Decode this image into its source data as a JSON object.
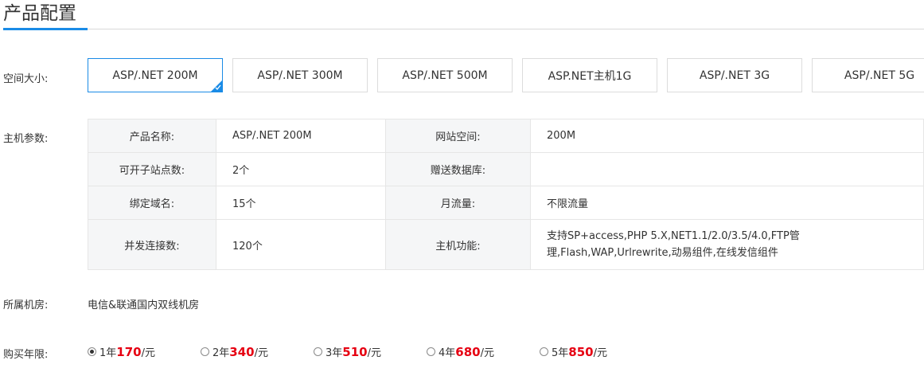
{
  "page_title": "产品配置",
  "labels": {
    "size": "空间大小:",
    "params": "主机参数:",
    "room": "所属机房:",
    "years": "购买年限:"
  },
  "size_options": [
    {
      "label": "ASP/.NET 200M",
      "selected": true
    },
    {
      "label": "ASP/.NET 300M",
      "selected": false
    },
    {
      "label": "ASP/.NET 500M",
      "selected": false
    },
    {
      "label": "ASP.NET主机1G",
      "selected": false
    },
    {
      "label": "ASP/.NET 3G",
      "selected": false
    },
    {
      "label": "ASP/.NET 5G",
      "selected": false
    }
  ],
  "params": [
    {
      "k1": "产品名称:",
      "v1": "ASP/.NET 200M",
      "k2": "网站空间:",
      "v2": "200M"
    },
    {
      "k1": "可开子站点数:",
      "v1": "2个",
      "k2": "赠送数据库:",
      "v2": ""
    },
    {
      "k1": "绑定域名:",
      "v1": "15个",
      "k2": "月流量:",
      "v2": "不限流量"
    },
    {
      "k1": "并发连接数:",
      "v1": "120个",
      "k2": "主机功能:",
      "v2": "支持SP+access,PHP 5.X,NET1.1/2.0/3.5/4.0,FTP管理,Flash,WAP,Urlrewrite,动易组件,在线发信组件"
    }
  ],
  "room_value": "电信&联通国内双线机房",
  "years": [
    {
      "year": "1年",
      "price": "170",
      "unit": "/元",
      "checked": true
    },
    {
      "year": "2年",
      "price": "340",
      "unit": "/元",
      "checked": false
    },
    {
      "year": "3年",
      "price": "510",
      "unit": "/元",
      "checked": false
    },
    {
      "year": "4年",
      "price": "680",
      "unit": "/元",
      "checked": false
    },
    {
      "year": "5年",
      "price": "850",
      "unit": "/元",
      "checked": false
    }
  ],
  "colors": {
    "accent": "#1a8be6",
    "price": "#e60012"
  }
}
